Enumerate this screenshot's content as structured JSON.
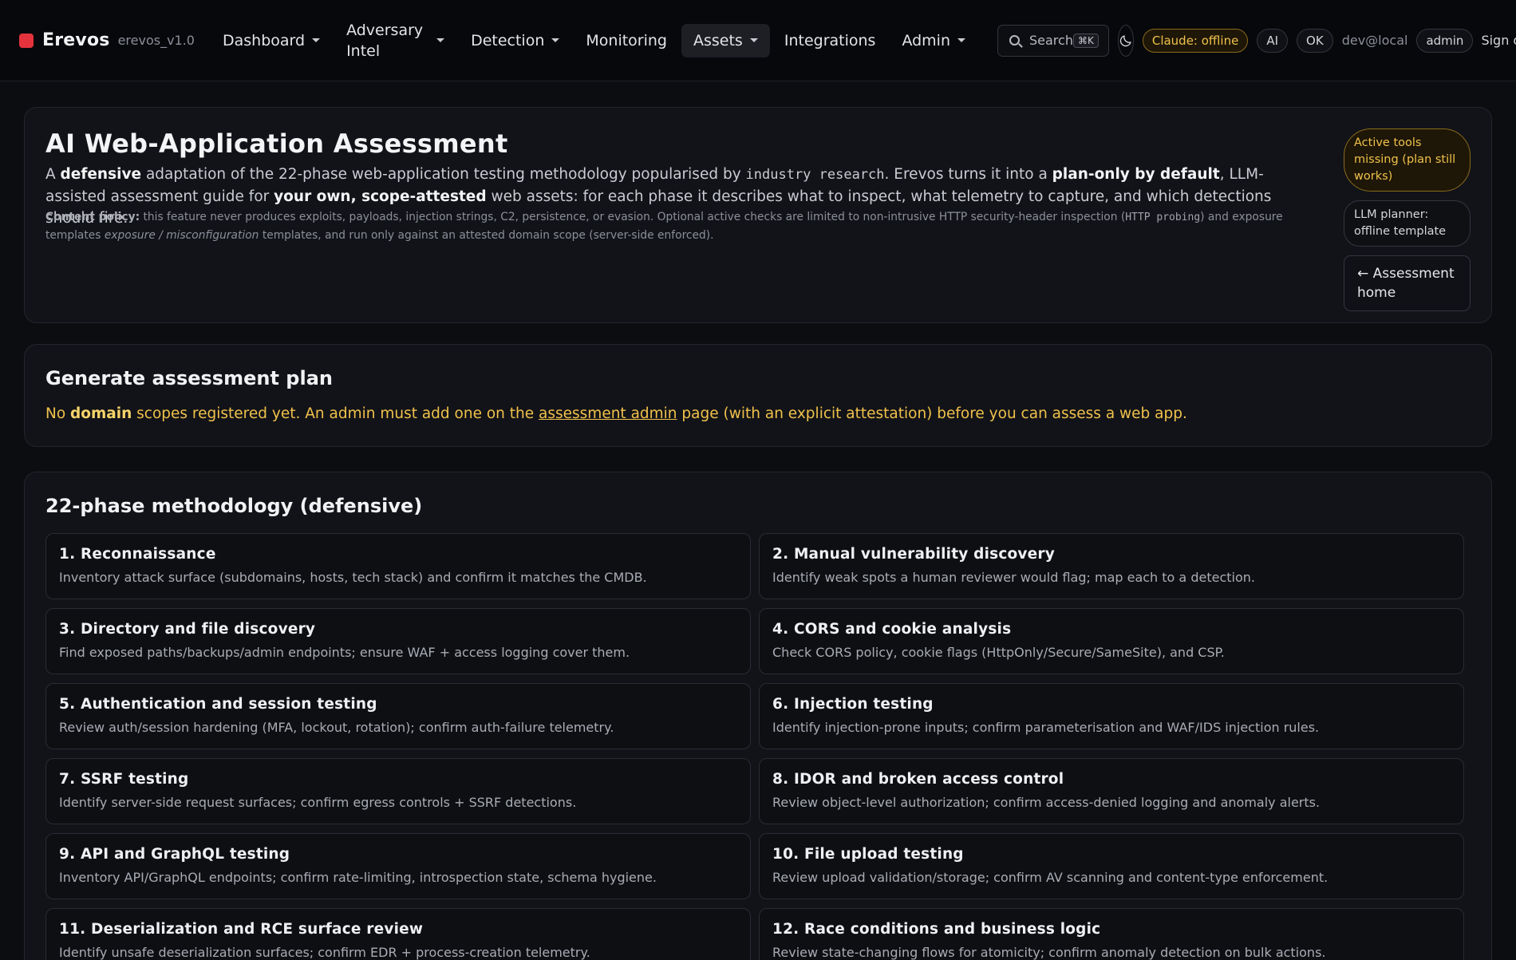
{
  "nav": {
    "brand": "Erevos",
    "version": "erevos_v1.0",
    "items": [
      {
        "label": "Dashboard",
        "dropdown": true
      },
      {
        "label": "Adversary Intel",
        "dropdown": true
      },
      {
        "label": "Detection",
        "dropdown": true
      },
      {
        "label": "Monitoring",
        "dropdown": false
      },
      {
        "label": "Assets",
        "dropdown": true,
        "active": true
      },
      {
        "label": "Integrations",
        "dropdown": false
      },
      {
        "label": "Admin",
        "dropdown": true
      }
    ],
    "search_label": "Search",
    "search_shortcut": "⌘K",
    "claude_status": "Claude: offline",
    "ai_label": "AI",
    "ok_label": "OK",
    "user": "dev@local",
    "role": "admin",
    "signout": "Sign ou"
  },
  "hero": {
    "title": "AI Web-Application Assessment",
    "intro": {
      "p1": "A ",
      "b1": "defensive",
      "p2": " adaptation of the 22-phase web-application testing methodology popularised by ",
      "code1": "industry research",
      "p3": ". Erevos turns it into a ",
      "b2": "plan-only by default",
      "p4": ", LLM-assisted assessment guide for ",
      "b3": "your own, scope-attested",
      "p5": " web assets: for each phase it describes what to inspect, what telemetry to capture, and which detections should fire."
    },
    "policy": {
      "label": "Content policy:",
      "p1": " this feature never produces exploits, payloads, injection strings, C2, persistence, or evasion. Optional active checks are limited to non-intrusive HTTP security-header inspection (",
      "code1": "HTTP probing",
      "p2": ") and exposure templates ",
      "em1": "exposure / misconfiguration",
      "p3": " templates, and run only against an attested domain scope (server-side enforced)."
    },
    "badge_tools": "Active tools missing (plan still works)",
    "badge_planner": "LLM planner: offline template",
    "home_button": "← Assessment home"
  },
  "plan": {
    "title": "Generate assessment plan",
    "msg_p1": "No ",
    "msg_b1": "domain",
    "msg_p2": " scopes registered yet. An admin must add one on the ",
    "msg_link": "assessment admin",
    "msg_p3": " page (with an explicit attestation) before you can assess a web app."
  },
  "method": {
    "title": "22-phase methodology (defensive)",
    "phases": [
      {
        "title": "1. Reconnaissance",
        "desc": "Inventory attack surface (subdomains, hosts, tech stack) and confirm it matches the CMDB."
      },
      {
        "title": "2. Manual vulnerability discovery",
        "desc": "Identify weak spots a human reviewer would flag; map each to a detection."
      },
      {
        "title": "3. Directory and file discovery",
        "desc": "Find exposed paths/backups/admin endpoints; ensure WAF + access logging cover them."
      },
      {
        "title": "4. CORS and cookie analysis",
        "desc": "Check CORS policy, cookie flags (HttpOnly/Secure/SameSite), and CSP."
      },
      {
        "title": "5. Authentication and session testing",
        "desc": "Review auth/session hardening (MFA, lockout, rotation); confirm auth-failure telemetry."
      },
      {
        "title": "6. Injection testing",
        "desc": "Identify injection-prone inputs; confirm parameterisation and WAF/IDS injection rules."
      },
      {
        "title": "7. SSRF testing",
        "desc": "Identify server-side request surfaces; confirm egress controls + SSRF detections."
      },
      {
        "title": "8. IDOR and broken access control",
        "desc": "Review object-level authorization; confirm access-denied logging and anomaly alerts."
      },
      {
        "title": "9. API and GraphQL testing",
        "desc": "Inventory API/GraphQL endpoints; confirm rate-limiting, introspection state, schema hygiene."
      },
      {
        "title": "10. File upload testing",
        "desc": "Review upload validation/storage; confirm AV scanning and content-type enforcement."
      },
      {
        "title": "11. Deserialization and RCE surface review",
        "desc": "Identify unsafe deserialization surfaces; confirm EDR + process-creation telemetry."
      },
      {
        "title": "12. Race conditions and business logic",
        "desc": "Review state-changing flows for atomicity; confirm anomaly detection on bulk actions."
      }
    ]
  }
}
